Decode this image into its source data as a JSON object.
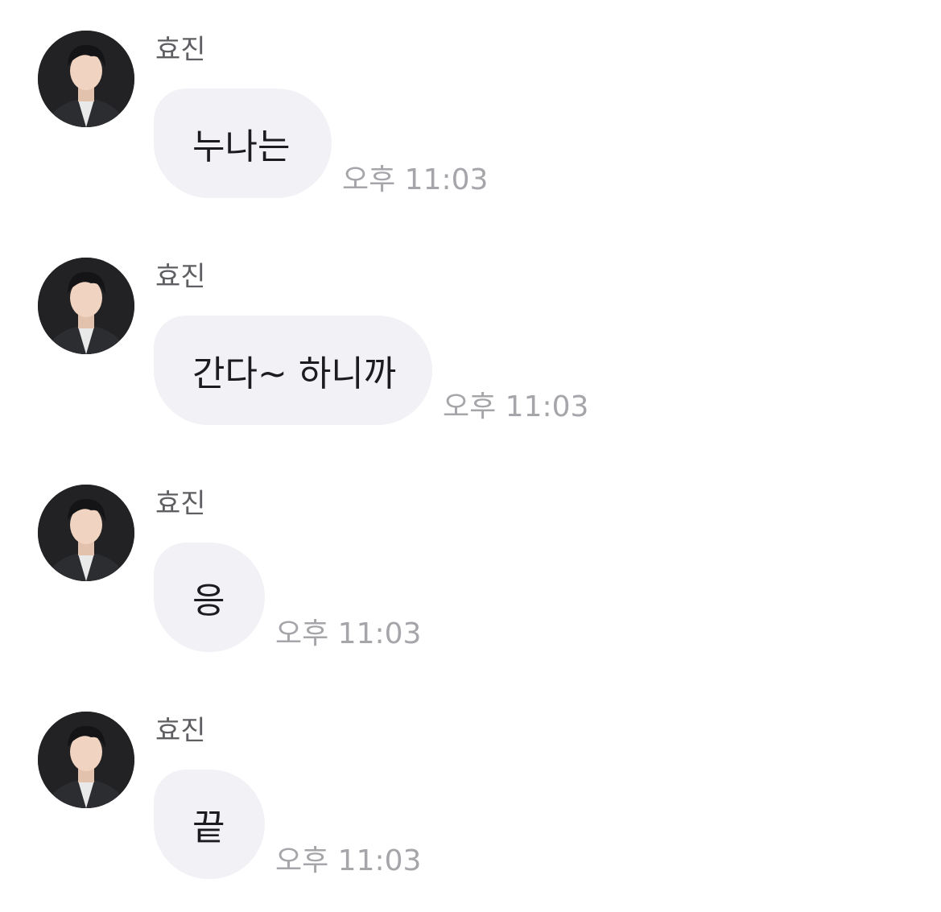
{
  "messages": [
    {
      "sender": "효진",
      "text": "누나는",
      "time": "오후 11:03"
    },
    {
      "sender": "효진",
      "text": "간다~ 하니까",
      "time": "오후 11:03"
    },
    {
      "sender": "효진",
      "text": "응",
      "time": "오후 11:03"
    },
    {
      "sender": "효진",
      "text": "끝",
      "time": "오후 11:03"
    }
  ],
  "colors": {
    "bubble": "#f2f2f6",
    "sender": "#5f5f63",
    "timestamp": "#a5a5aa",
    "text": "#1c1c1e"
  },
  "icons": {
    "avatar": "profile-photo"
  }
}
